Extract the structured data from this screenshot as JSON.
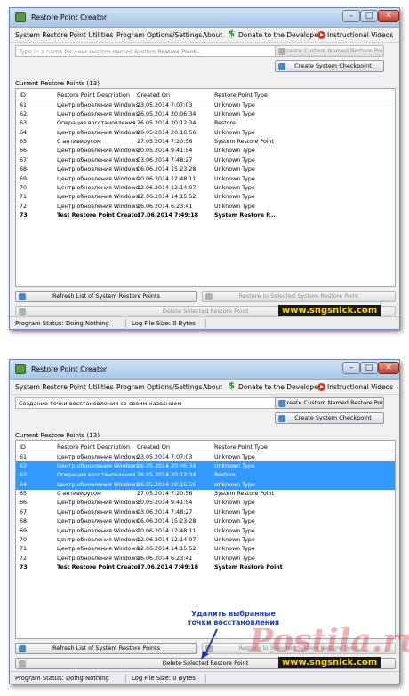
{
  "app_title": "Restore Point Creator",
  "menu": {
    "utilities": "System Restore Point Utilities",
    "options": "Program Options/Settings",
    "about": "About",
    "donate": "Donate to the Developer",
    "videos": "Instructional Videos"
  },
  "window_controls": {
    "minimize": "–",
    "maximize": "□",
    "close": "✕"
  },
  "input": {
    "placeholder": "Type in a name for your custom-named System Restore Point...",
    "value_filled": "Создание точки восстановления со своим названием"
  },
  "buttons": {
    "create_custom": "Create Custom Named Restore Point",
    "create_checkpoint": "Create System Checkpoint",
    "refresh": "Refresh List of System Restore Points",
    "restore_selected": "Restore to Selected System Restore Point",
    "delete_selected": "Delete Selected Restore Point"
  },
  "list": {
    "label": "Current Restore Points (13)",
    "columns": [
      "ID",
      "Restore Point Description",
      "Created On",
      "Restore Point Type"
    ],
    "rows": [
      {
        "id": "61",
        "desc": "Центр обновления Windows",
        "date": "23.05.2014 7:07:03",
        "type": "Unknown Type"
      },
      {
        "id": "62",
        "desc": "Центр обновления Windows",
        "date": "26.05.2014 20:06:34",
        "type": "Unknown Type"
      },
      {
        "id": "63",
        "desc": "Операция восстановления",
        "date": "26.05.2014 20:12:34",
        "type": "Restore"
      },
      {
        "id": "64",
        "desc": "Центр обновления Windows",
        "date": "26.05.2014 20:16:56",
        "type": "Unknown Type"
      },
      {
        "id": "65",
        "desc": "С антивирусом",
        "date": "27.05.2014 7:20:56",
        "type": "System Restore Point"
      },
      {
        "id": "66",
        "desc": "Центр обновления Windows",
        "date": "30.05.2014 9:41:54",
        "type": "Unknown Type"
      },
      {
        "id": "67",
        "desc": "Центр обновления Windows",
        "date": "03.06.2014 7:48:27",
        "type": "Unknown Type"
      },
      {
        "id": "68",
        "desc": "Центр обновления Windows",
        "date": "06.06.2014 15:23:28",
        "type": "Unknown Type"
      },
      {
        "id": "69",
        "desc": "Центр обновления Windows",
        "date": "10.06.2014 12:48:11",
        "type": "Unknown Type"
      },
      {
        "id": "70",
        "desc": "Центр обновления Windows",
        "date": "12.06.2014 12:14:07",
        "type": "Unknown Type"
      },
      {
        "id": "71",
        "desc": "Центр обновления Windows",
        "date": "12.06.2014 14:15:52",
        "type": "Unknown Type"
      },
      {
        "id": "72",
        "desc": "Центр обновления Windows",
        "date": "16.06.2014 6:23:41",
        "type": "Unknown Type"
      },
      {
        "id": "73",
        "desc": "Test Restore Point Creator",
        "date": "17.06.2014 7:49:18",
        "type": "System Restore P..."
      }
    ],
    "second_list_types": [
      "Unknown Type",
      "Unknown Type",
      "Restore",
      "Unknown Type",
      "System Restore Point",
      "Unknown Type",
      "Unknown Type",
      "Unknown Type",
      "Unknown Type",
      "Unknown Type",
      "Unknown Type",
      "Unknown Type",
      "System Restore Point"
    ],
    "selected_ids_window2": [
      "62",
      "63",
      "64"
    ]
  },
  "status": {
    "program": "Program Status:  Doing Nothing",
    "log": "Log File Size:  0 Bytes"
  },
  "watermark": "www.sngsnick.com",
  "annotation": "Удалить выбранные точки восстановления",
  "big_watermark": "Postila.ru",
  "colors": {
    "selection": "#3399ff",
    "annotation": "#1f3fa8",
    "watermark_text": "#ffd400"
  }
}
